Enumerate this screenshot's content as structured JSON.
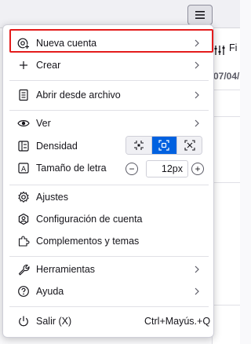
{
  "background": {
    "filter_text": "Fi",
    "date_text": "07/04/"
  },
  "menu": {
    "new_account": "Nueva cuenta",
    "create": "Crear",
    "open_file": "Abrir desde archivo",
    "view": "Ver",
    "density": "Densidad",
    "font_size": "Tamaño de letra",
    "font_size_value": "12px",
    "font_decrease": "−",
    "font_increase": "+",
    "settings": "Ajustes",
    "account_settings": "Configuración de cuenta",
    "addons": "Complementos y temas",
    "tools": "Herramientas",
    "help": "Ayuda",
    "exit": "Salir (X)",
    "exit_shortcut": "Ctrl+Mayús.+Q"
  },
  "colors": {
    "accent": "#0061e0",
    "highlight_border": "#e41c1c"
  }
}
